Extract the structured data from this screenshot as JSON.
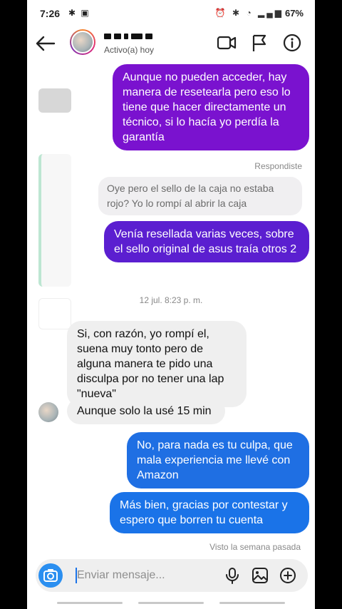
{
  "status_bar": {
    "time": "7:26",
    "battery": "67%"
  },
  "header": {
    "status": "Activo(a) hoy"
  },
  "messages": {
    "m1": "Aunque no pueden acceder, hay manera de resetearla pero eso lo tiene que hacer directamente un técnico, si lo hacía yo perdía la garantía",
    "reply_label": "Respondiste",
    "quoted": "Oye pero el sello de la caja no estaba rojo? Yo lo rompí al abrir la caja",
    "m2": "Venía resellada varias veces, sobre el sello original de asus traía otros 2",
    "timestamp": "12 jul. 8:23 p. m.",
    "m3": "Si, con razón, yo rompí el, suena muy tonto pero de alguna manera te pido una disculpa por no tener una lap \"nueva\"",
    "m4": "Aunque solo la usé 15 min",
    "m5": "No, para nada es tu culpa, que mala experiencia me llevé con Amazon",
    "m6": "Más bien, gracias por contestar y espero que borren tu cuenta",
    "seen": "Visto la semana pasada"
  },
  "composer": {
    "placeholder": "Enviar mensaje..."
  },
  "colors": {
    "purple": "#7a12cf",
    "violet": "#5b1fd0",
    "blue": "#1f6fe3",
    "incoming": "#efefef"
  }
}
